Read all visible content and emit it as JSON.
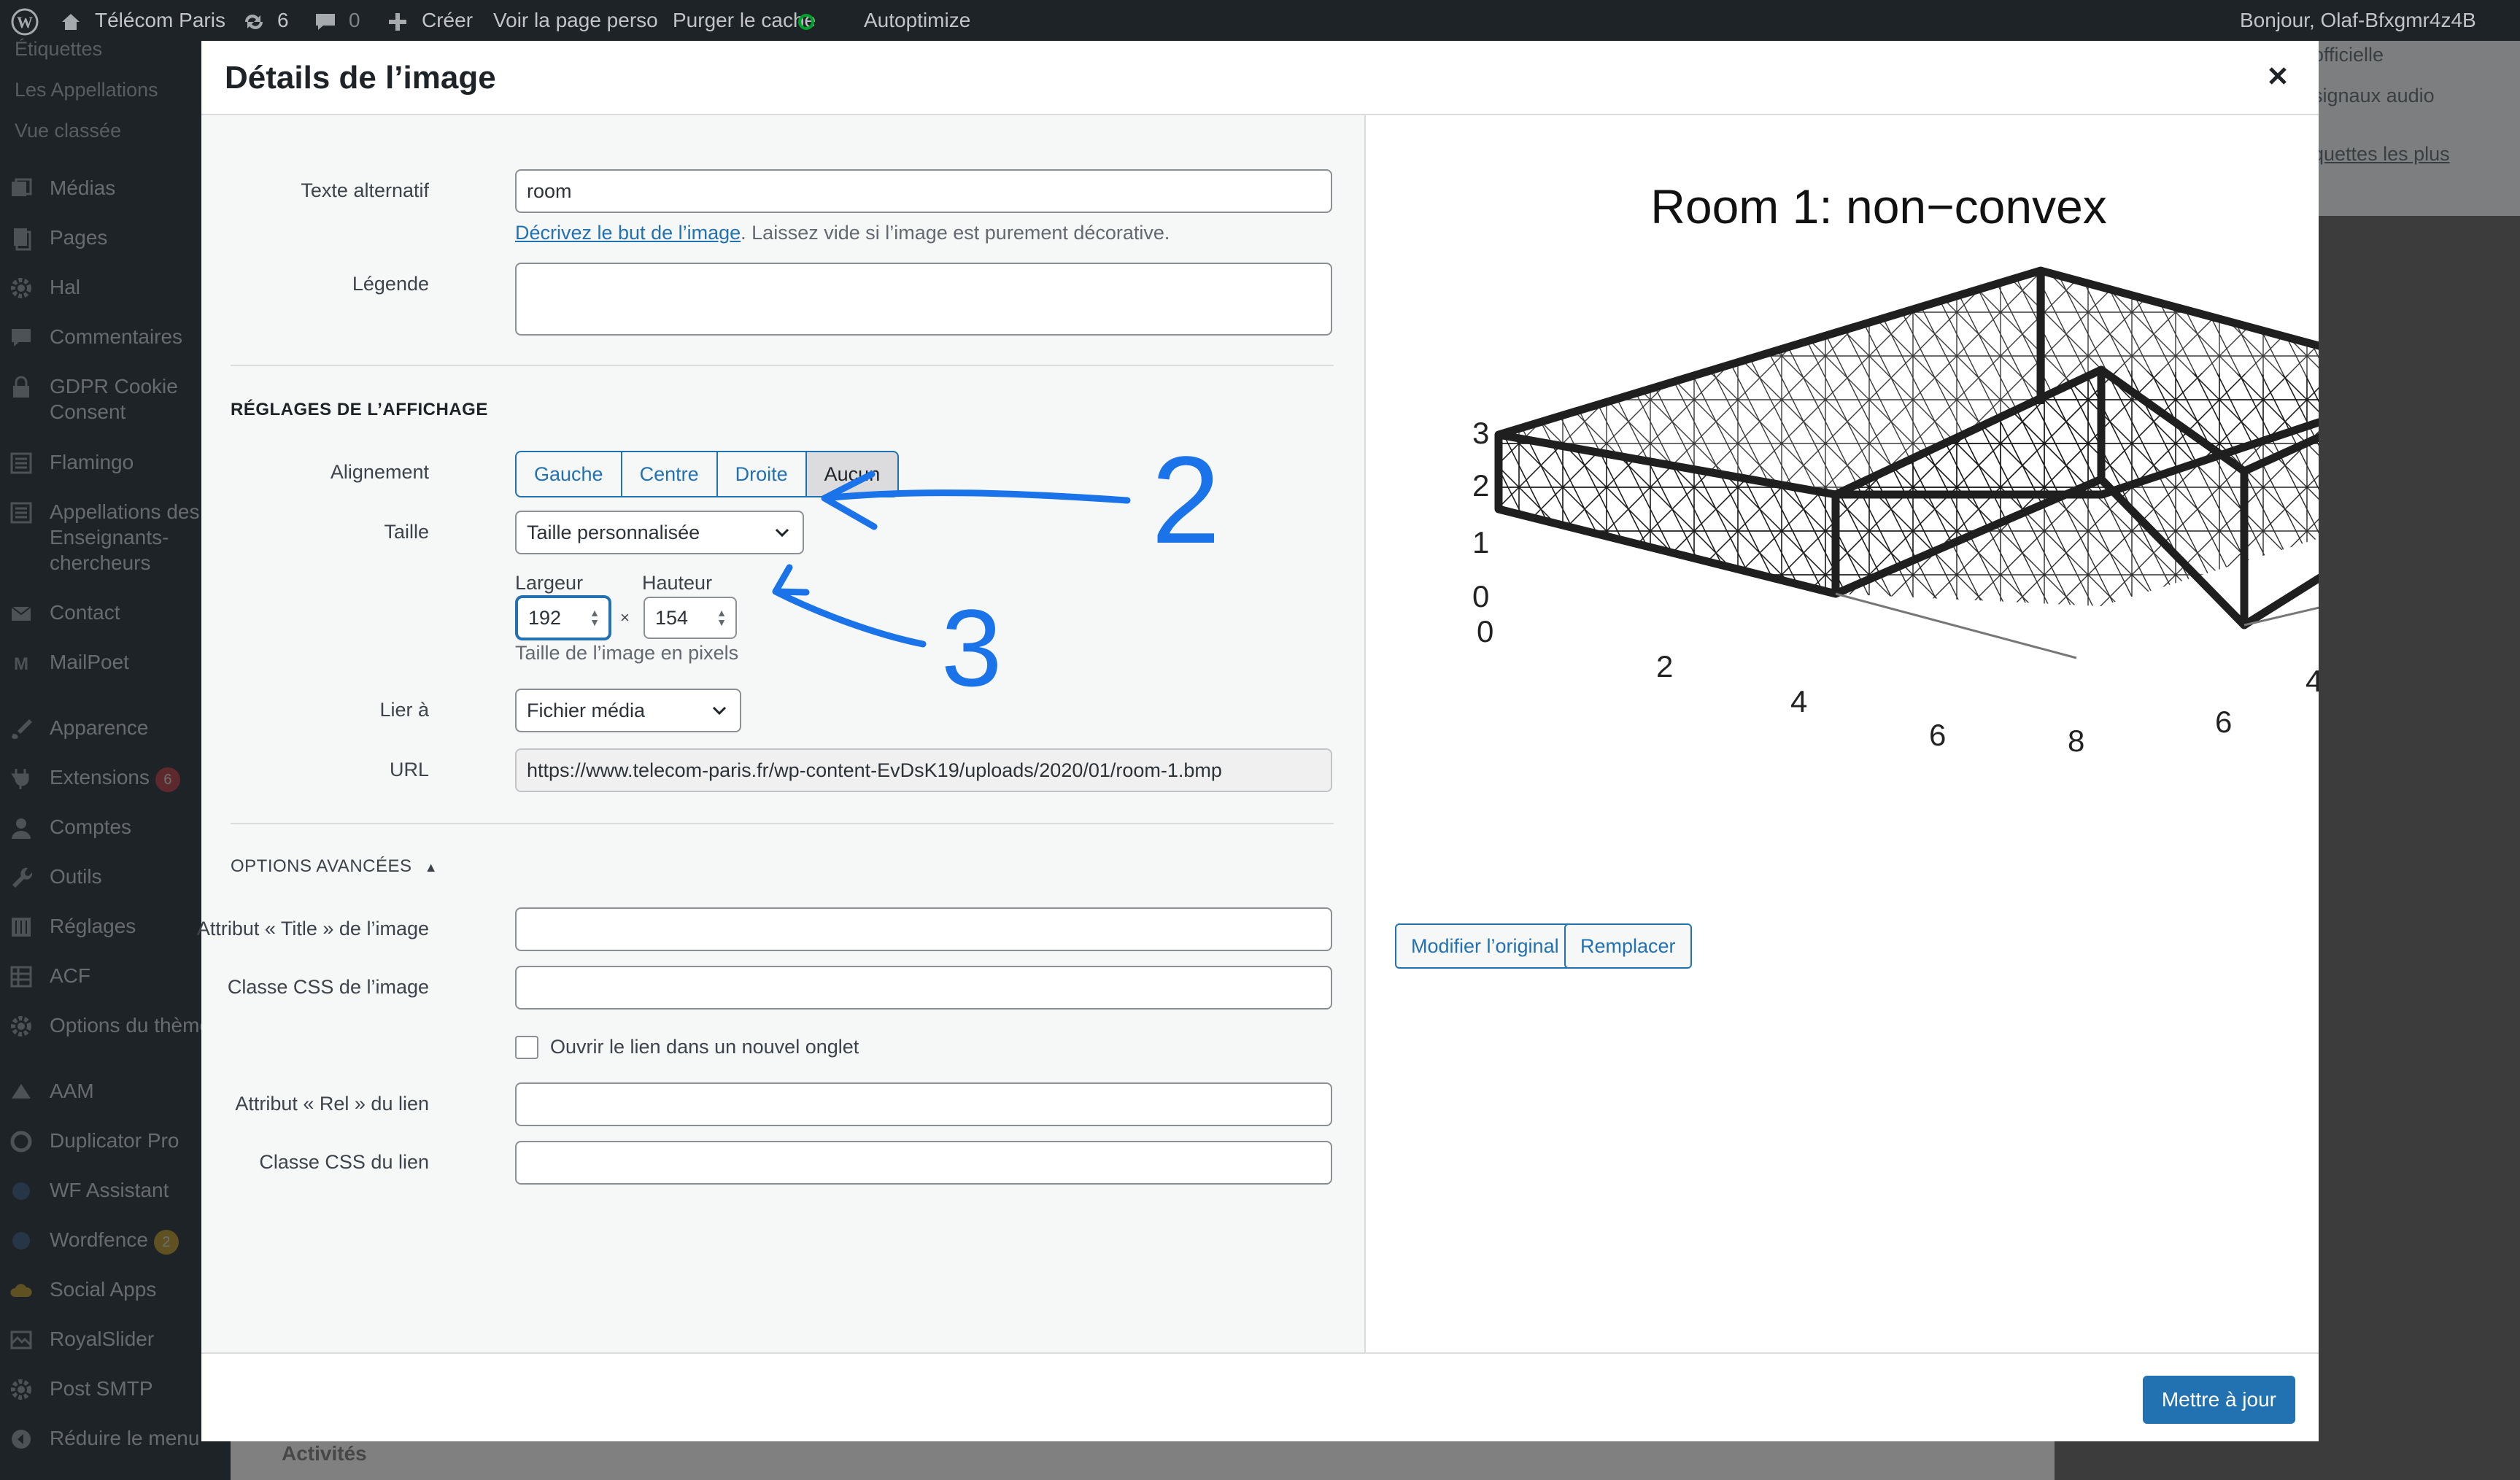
{
  "admin_bar": {
    "site_name": "Télécom Paris",
    "updates_count": "6",
    "comments_count": "0",
    "new_label": "Créer",
    "view_page": "Voir la page perso",
    "purge_cache": "Purger le cache",
    "autoptimize": "Autoptimize",
    "greeting": "Bonjour, Olaf-Bfxgmr4z4B"
  },
  "sidebar": {
    "sub_items": [
      "Étiquettes",
      "Les Appellations",
      "Vue classée"
    ],
    "items": [
      {
        "label": "Médias",
        "icon": "media-icon"
      },
      {
        "label": "Pages",
        "icon": "pages-icon"
      },
      {
        "label": "Hal",
        "icon": "gear-icon"
      },
      {
        "label": "Commentaires",
        "icon": "comment-icon"
      },
      {
        "label": "GDPR Cookie Consent",
        "icon": "lock-icon"
      },
      {
        "label": "Flamingo",
        "icon": "list-icon"
      },
      {
        "label": "Appellations des Enseignants-chercheurs",
        "icon": "list-icon"
      },
      {
        "label": "Contact",
        "icon": "mail-icon"
      },
      {
        "label": "MailPoet",
        "icon": "mailpoet-icon"
      },
      {
        "label": "Apparence",
        "icon": "brush-icon"
      },
      {
        "label": "Extensions",
        "icon": "plug-icon",
        "badge": "6"
      },
      {
        "label": "Comptes",
        "icon": "user-icon"
      },
      {
        "label": "Outils",
        "icon": "wrench-icon"
      },
      {
        "label": "Réglages",
        "icon": "settings-icon"
      },
      {
        "label": "ACF",
        "icon": "grid-icon"
      },
      {
        "label": "Options du thème",
        "icon": "gear-icon"
      },
      {
        "label": "AAM",
        "icon": "aam-icon"
      },
      {
        "label": "Duplicator Pro",
        "icon": "duplicator-icon"
      },
      {
        "label": "WF Assistant",
        "icon": "assistant-icon"
      },
      {
        "label": "Wordfence",
        "icon": "wordfence-icon",
        "badge": "2"
      },
      {
        "label": "Social Apps",
        "icon": "cloud-icon"
      },
      {
        "label": "RoyalSlider",
        "icon": "slider-icon"
      },
      {
        "label": "Post SMTP",
        "icon": "gear-icon"
      },
      {
        "label": "Réduire le menu",
        "icon": "collapse-icon"
      }
    ]
  },
  "background": {
    "right_panel_lines": [
      "officielle",
      "signaux audio",
      "quettes les plus"
    ],
    "bottom_heading": "Activités"
  },
  "modal": {
    "title": "Détails de l’image",
    "alt_text": {
      "label": "Texte alternatif",
      "value": "room"
    },
    "alt_help": {
      "link": "Décrivez le but de l’image",
      "text": ". Laissez vide si l’image est purement décorative."
    },
    "caption": {
      "label": "Légende",
      "value": ""
    },
    "display_settings_heading": "RÉGLAGES DE L’AFFICHAGE",
    "alignment": {
      "label": "Alignement",
      "options": [
        "Gauche",
        "Centre",
        "Droite",
        "Aucun"
      ],
      "selected": "Aucun"
    },
    "size": {
      "label": "Taille",
      "value": "Taille personnalisée"
    },
    "width": {
      "label": "Largeur",
      "value": "192"
    },
    "height": {
      "label": "Hauteur",
      "value": "154"
    },
    "times": "×",
    "size_help": "Taille de l’image en pixels",
    "link_to": {
      "label": "Lier à",
      "value": "Fichier média"
    },
    "url": {
      "label": "URL",
      "value": "https://www.telecom-paris.fr/wp-content-EvDsK19/uploads/2020/01/room-1.bmp"
    },
    "advanced_heading": "OPTIONS AVANCÉES",
    "title_attr": {
      "label": "Attribut « Title » de l’image",
      "value": ""
    },
    "css_class": {
      "label": "Classe CSS de l’image",
      "value": ""
    },
    "new_tab": {
      "label": "Ouvrir le lien dans un nouvel onglet",
      "checked": false
    },
    "rel_attr": {
      "label": "Attribut « Rel » du lien",
      "value": ""
    },
    "link_css": {
      "label": "Classe CSS du lien",
      "value": ""
    },
    "edit_original": "Modifier l’original",
    "replace": "Remplacer",
    "update": "Mettre à jour"
  },
  "annotations": {
    "arrow_2": "2",
    "arrow_3": "3",
    "color": "#1a73e8"
  },
  "preview_image": {
    "title": "Room 1: non−convex",
    "z_ticks": [
      "0",
      "1",
      "2",
      "3"
    ],
    "x_ticks": [
      "0",
      "2",
      "4",
      "6"
    ],
    "y_ticks": [
      "0",
      "2",
      "4",
      "6",
      "8"
    ]
  }
}
